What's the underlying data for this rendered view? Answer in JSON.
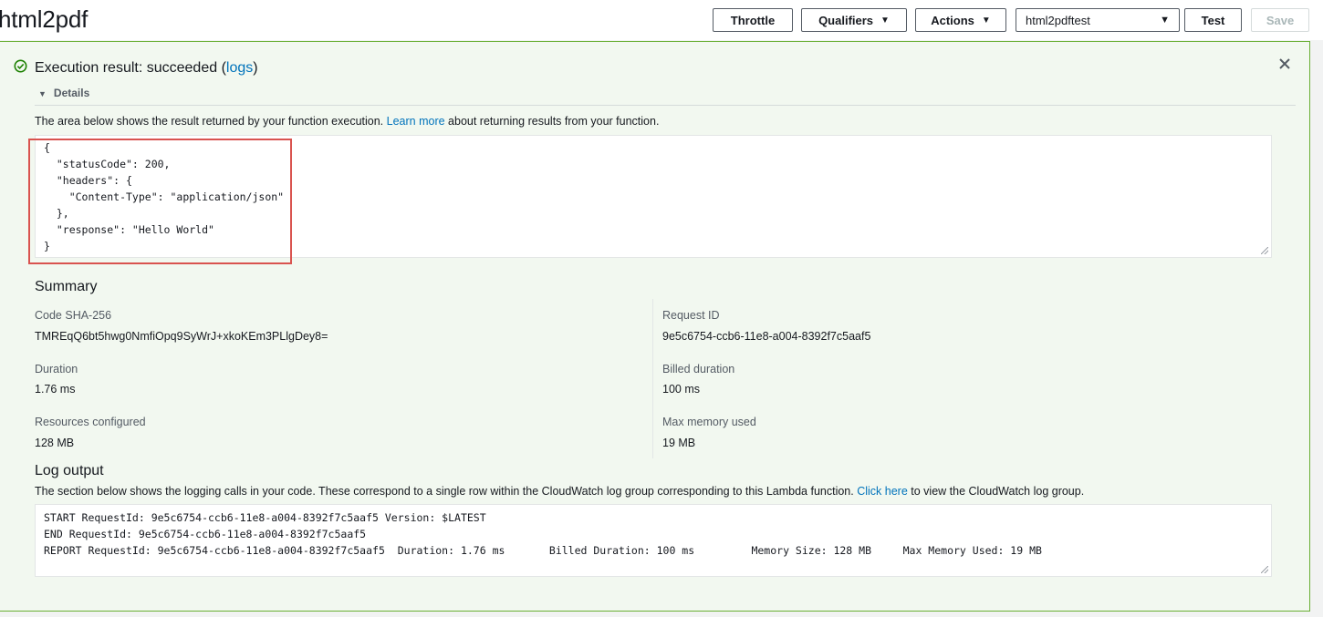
{
  "header": {
    "title": "html2pdf",
    "throttle_label": "Throttle",
    "qualifiers_label": "Qualifiers",
    "actions_label": "Actions",
    "test_event_selected": "html2pdftest",
    "test_label": "Test",
    "save_label": "Save"
  },
  "result": {
    "title_prefix": "Execution result: succeeded (",
    "logs_link": "logs",
    "title_suffix": ")",
    "details_label": "Details",
    "desc_before": "The area below shows the result returned by your function execution. ",
    "learn_more": "Learn more",
    "desc_after": " about returning results from your function.",
    "output": "{\n  \"statusCode\": 200,\n  \"headers\": {\n    \"Content-Type\": \"application/json\"\n  },\n  \"response\": \"Hello World\"\n}"
  },
  "summary": {
    "title": "Summary",
    "code_sha_label": "Code SHA-256",
    "code_sha_value": "TMREqQ6bt5hwg0NmfiOpq9SyWrJ+xkoKEm3PLlgDey8=",
    "request_id_label": "Request ID",
    "request_id_value": "9e5c6754-ccb6-11e8-a004-8392f7c5aaf5",
    "duration_label": "Duration",
    "duration_value": "1.76 ms",
    "billed_label": "Billed duration",
    "billed_value": "100 ms",
    "resources_label": "Resources configured",
    "resources_value": "128 MB",
    "max_memory_label": "Max memory used",
    "max_memory_value": "19 MB"
  },
  "log": {
    "title": "Log output",
    "desc_before": "The section below shows the logging calls in your code. These correspond to a single row within the CloudWatch log group corresponding to this Lambda function. ",
    "click_here": "Click here",
    "desc_after": " to view the CloudWatch log group.",
    "output": "START RequestId: 9e5c6754-ccb6-11e8-a004-8392f7c5aaf5 Version: $LATEST\nEND RequestId: 9e5c6754-ccb6-11e8-a004-8392f7c5aaf5\nREPORT RequestId: 9e5c6754-ccb6-11e8-a004-8392f7c5aaf5  Duration: 1.76 ms\tBilled Duration: 100 ms \tMemory Size: 128 MB\tMax Memory Used: 19 MB"
  },
  "icons": {
    "success": "check-circle-icon",
    "close": "close-icon",
    "dropdown": "caret-down-icon"
  },
  "colors": {
    "success_border": "#6aaf35",
    "link": "#0073bb",
    "highlight_box": "#d9534f"
  }
}
